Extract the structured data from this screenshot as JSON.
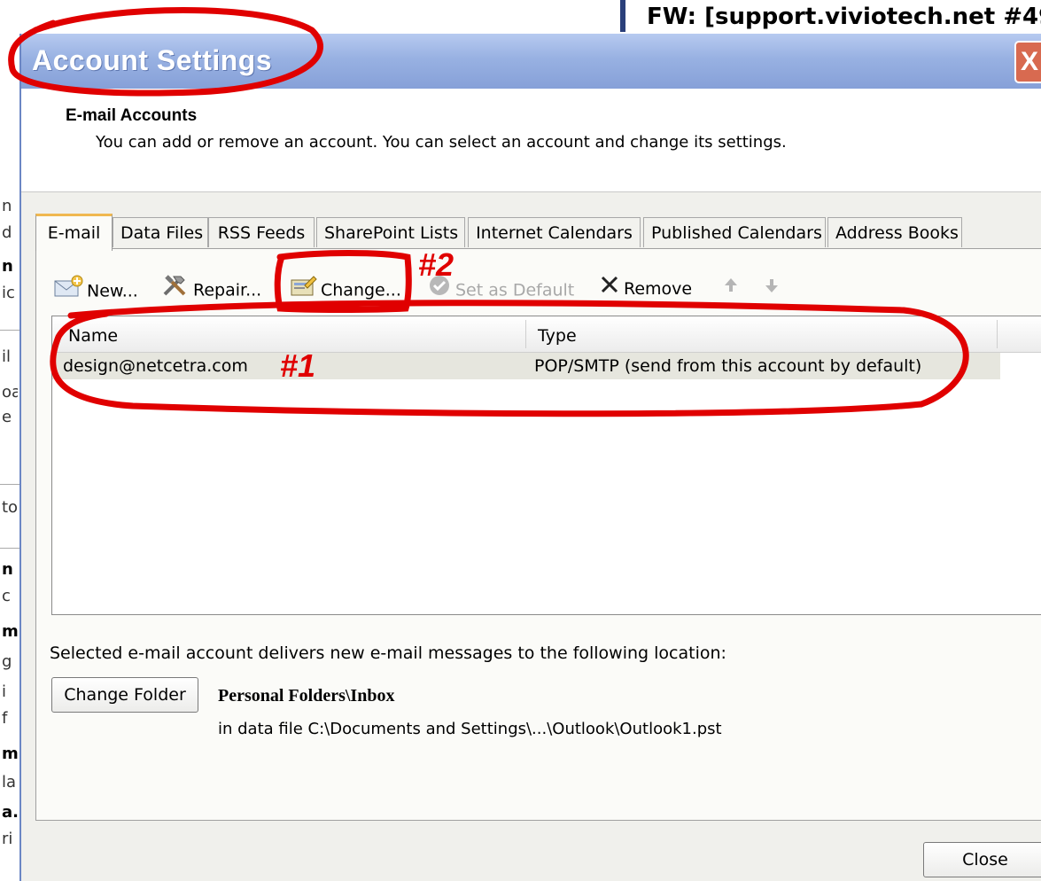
{
  "background": {
    "window_title": "FW: [support.viviotech.net #49",
    "left_fragments": [
      "n",
      "d",
      "n",
      "ic",
      "il",
      "oa",
      "e",
      "to",
      "n",
      "c",
      "m",
      "g",
      "i",
      "f",
      "m",
      "la",
      "a.",
      "ri"
    ]
  },
  "dialog": {
    "title": "Account Settings",
    "close_glyph": "X"
  },
  "header": {
    "title": "E-mail Accounts",
    "description": "You can add or remove an account. You can select an account and change its settings."
  },
  "tabs": [
    {
      "label": "E-mail",
      "active": true
    },
    {
      "label": "Data Files",
      "active": false
    },
    {
      "label": "RSS Feeds",
      "active": false
    },
    {
      "label": "SharePoint Lists",
      "active": false
    },
    {
      "label": "Internet Calendars",
      "active": false
    },
    {
      "label": "Published Calendars",
      "active": false
    },
    {
      "label": "Address Books",
      "active": false
    }
  ],
  "toolbar": {
    "new_label": "New...",
    "repair_label": "Repair...",
    "change_label": "Change...",
    "set_default_label": "Set as Default",
    "remove_label": "Remove"
  },
  "accounts_list": {
    "columns": {
      "name": "Name",
      "type": "Type"
    },
    "rows": [
      {
        "name": "design@netcetra.com",
        "type": "POP/SMTP (send from this account by default)"
      }
    ]
  },
  "delivery": {
    "text": "Selected e-mail account delivers new e-mail messages to the following location:",
    "change_folder_label": "Change Folder",
    "folder_name": "Personal Folders\\Inbox",
    "data_file_path": "in data file C:\\Documents and Settings\\...\\Outlook\\Outlook1.pst"
  },
  "footer": {
    "close_label": "Close"
  },
  "annotations": {
    "label_1": "#1",
    "label_2": "#2",
    "color": "#e00000"
  }
}
